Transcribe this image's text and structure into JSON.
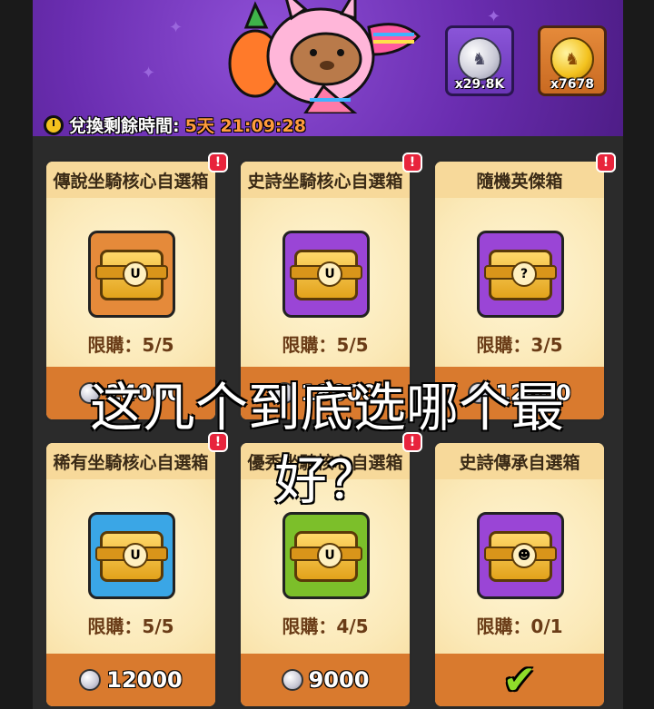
{
  "header": {
    "timer_label": "兌換剩餘時間:",
    "timer_value": "5天 21:09:28",
    "currencies": [
      {
        "name": "silver-coin",
        "amount": "x29.8K",
        "glyph": "♞"
      },
      {
        "name": "gold-coin",
        "amount": "x7678",
        "glyph": "♞"
      }
    ]
  },
  "cards": [
    {
      "title": "傳說坐騎核心自選箱",
      "limit": "限購：5/5",
      "price": "24000",
      "box_color": "#e58a3a",
      "emblem": "U",
      "alert": "!"
    },
    {
      "title": "史詩坐騎核心自選箱",
      "limit": "限購：5/5",
      "price": "18000",
      "box_color": "#9a45d6",
      "emblem": "U",
      "alert": "!"
    },
    {
      "title": "隨機英傑箱",
      "limit": "限購：3/5",
      "price": "12800",
      "box_color": "#9a45d6",
      "emblem": "?",
      "alert": "!"
    },
    {
      "title": "稀有坐騎核心自選箱",
      "limit": "限購：5/5",
      "price": "12000",
      "box_color": "#3aa6e6",
      "emblem": "U",
      "alert": "!"
    },
    {
      "title": "優秀坐騎核心自選箱",
      "limit": "限購：4/5",
      "price": "9000",
      "box_color": "#7cbf2a",
      "emblem": "U",
      "alert": "!"
    },
    {
      "title": "史詩傳承自選箱",
      "limit": "限購：0/1",
      "price": "",
      "box_color": "#9a45d6",
      "emblem": "☻",
      "alert": "",
      "purchased_mark": "✔"
    }
  ],
  "overlay_text": {
    "line1": "这几个到底选哪个最",
    "line2": "好？"
  }
}
